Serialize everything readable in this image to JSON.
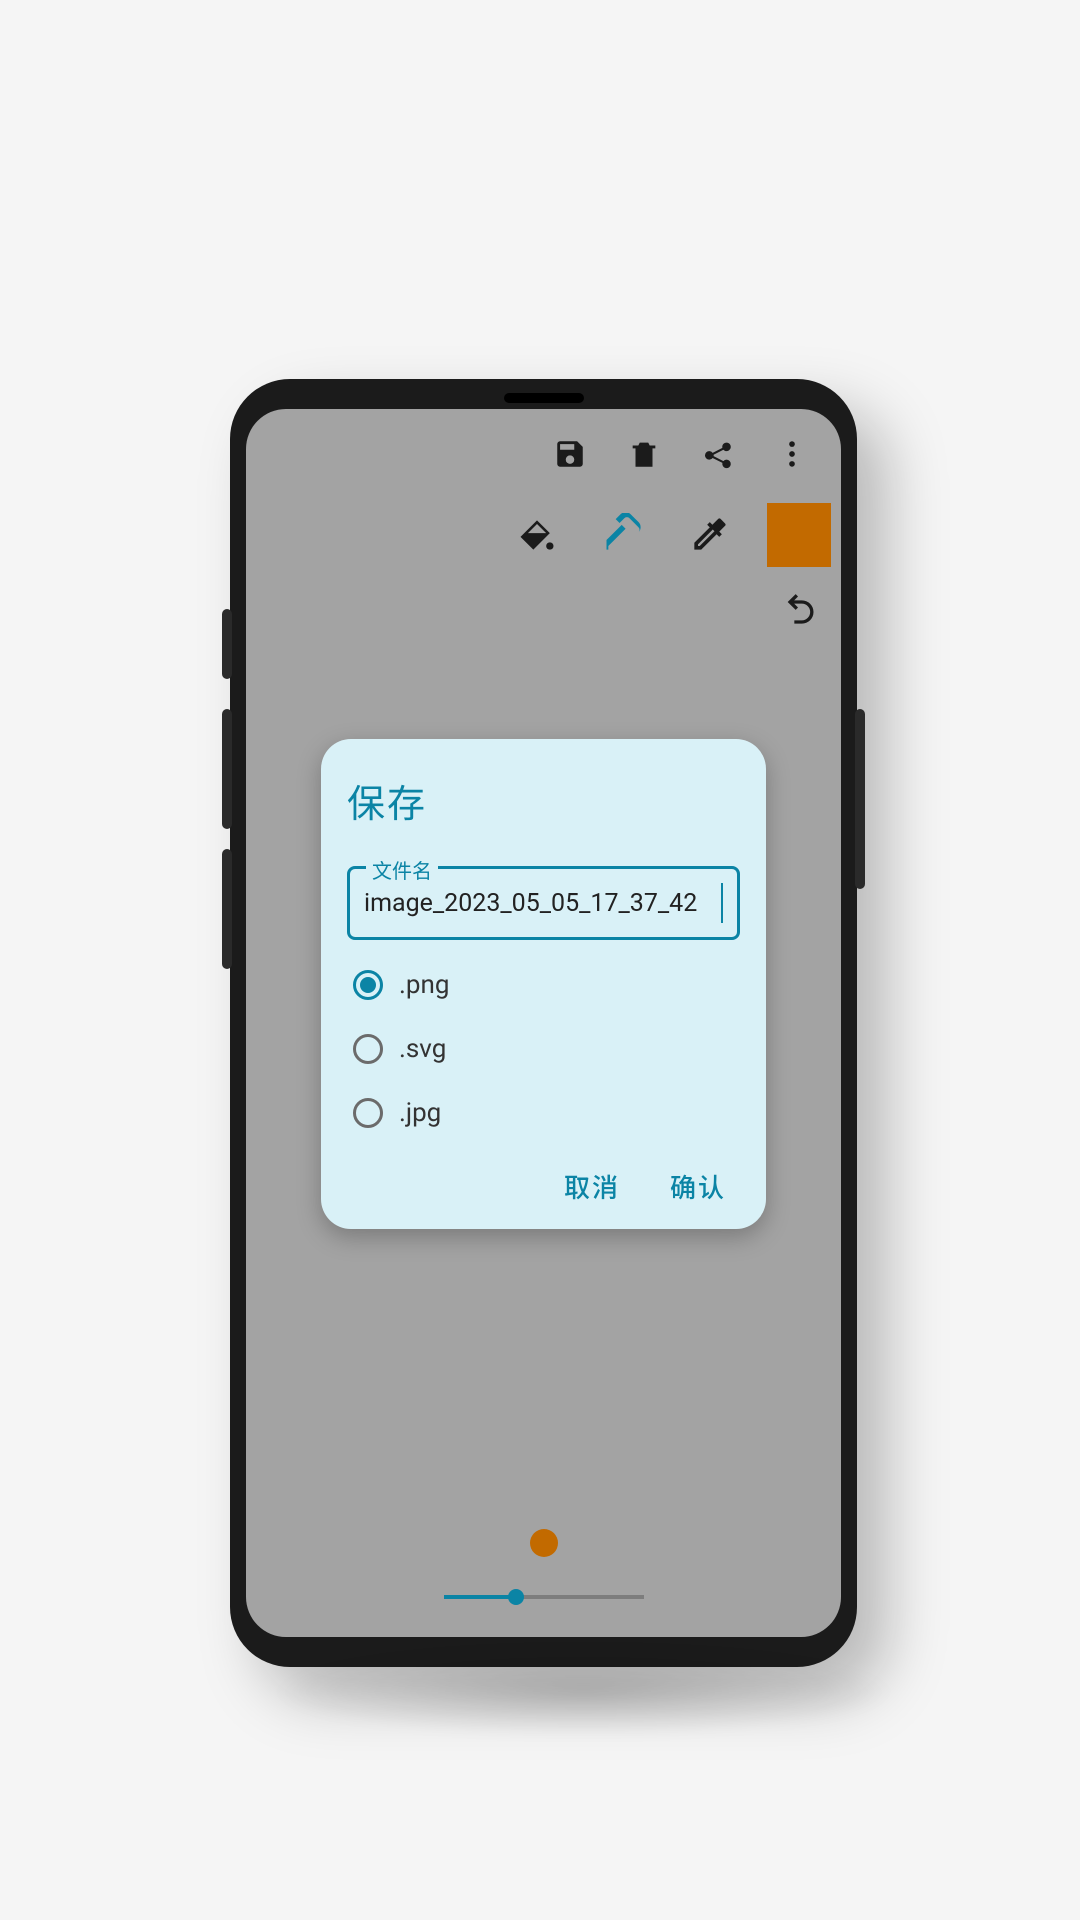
{
  "colors": {
    "accent": "#0b84a5",
    "swatch": "#c26a00"
  },
  "actionbar": {
    "save_icon": "save-icon",
    "delete_icon": "trash-icon",
    "share_icon": "share-icon",
    "overflow_icon": "more-vert-icon"
  },
  "tools": {
    "fill_icon": "paint-bucket-icon",
    "eraser_icon": "eraser-icon",
    "eyedropper_icon": "eyedropper-icon",
    "current_color": "#c26a00",
    "undo_icon": "undo-icon"
  },
  "brush": {
    "preview_color": "#c26a00",
    "size_percent": 35
  },
  "dialog": {
    "title": "保存",
    "filename_label": "文件名",
    "filename_value": "image_2023_05_05_17_37_42",
    "formats": [
      {
        "label": ".png",
        "selected": true
      },
      {
        "label": ".svg",
        "selected": false
      },
      {
        "label": ".jpg",
        "selected": false
      }
    ],
    "cancel_label": "取消",
    "confirm_label": "确认"
  }
}
